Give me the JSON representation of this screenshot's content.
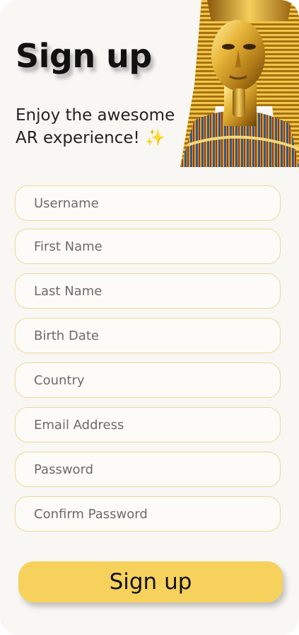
{
  "header": {
    "title": "Sign up",
    "subtitle_line1": "Enjoy the awesome",
    "subtitle_line2": "AR experience!",
    "sparkle": "✨"
  },
  "form": {
    "fields": [
      {
        "placeholder": "Username",
        "value": ""
      },
      {
        "placeholder": "First Name",
        "value": ""
      },
      {
        "placeholder": "Last Name",
        "value": ""
      },
      {
        "placeholder": "Birth Date",
        "value": ""
      },
      {
        "placeholder": "Country",
        "value": ""
      },
      {
        "placeholder": "Email Address",
        "value": ""
      },
      {
        "placeholder": "Password",
        "value": ""
      },
      {
        "placeholder": "Confirm Password",
        "value": ""
      }
    ],
    "submit_label": "Sign up"
  },
  "colors": {
    "background": "#f8f7f4",
    "field_border": "#ecd894",
    "button": "#f6d25d",
    "text": "#111111"
  }
}
